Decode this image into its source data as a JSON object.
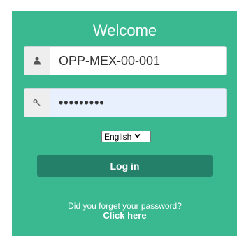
{
  "login": {
    "title": "Welcome",
    "username": {
      "value": "OPP-MEX-00-001",
      "icon": "user-icon"
    },
    "password": {
      "value": "•••••••••",
      "icon": "key-icon"
    },
    "language": {
      "selected": "English",
      "icon": "chevron-down-icon"
    },
    "login_button": "Log in",
    "forgot_text": "Did you forget your password?",
    "forgot_link": "Click here"
  },
  "colors": {
    "panel": "#3ab88f",
    "button": "#25806a",
    "autofill": "#e8f0fe"
  }
}
